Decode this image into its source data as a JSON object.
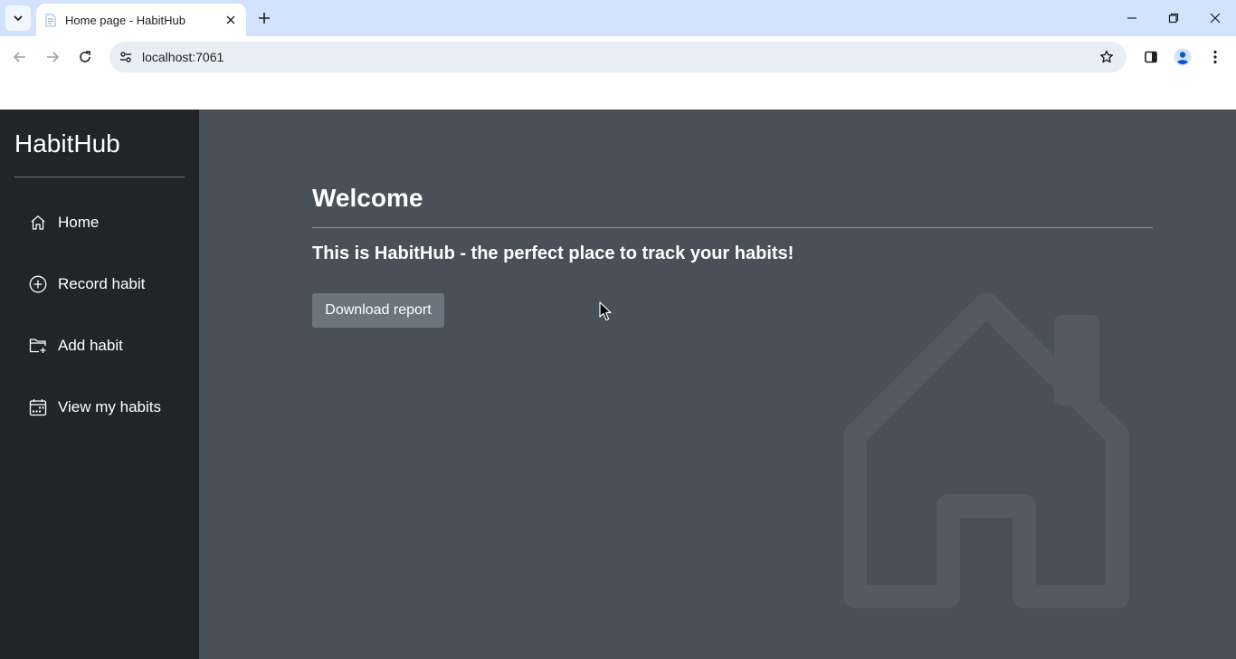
{
  "browser": {
    "tab_title": "Home page - HabitHub",
    "url": "localhost:7061"
  },
  "app": {
    "brand": "HabitHub",
    "nav": [
      {
        "label": "Home",
        "icon": "house-icon"
      },
      {
        "label": "Record habit",
        "icon": "plus-circle-icon"
      },
      {
        "label": "Add habit",
        "icon": "folder-plus-icon"
      },
      {
        "label": "View my habits",
        "icon": "calendar-icon"
      }
    ],
    "main": {
      "heading": "Welcome",
      "lead": "This is HabitHub - the perfect place to track your habits!",
      "download_button": "Download report"
    }
  },
  "colors": {
    "sidebar_bg": "#212529",
    "main_bg": "#495057",
    "button_bg": "#6c757d",
    "tabstrip_bg": "#d3e3fd"
  }
}
